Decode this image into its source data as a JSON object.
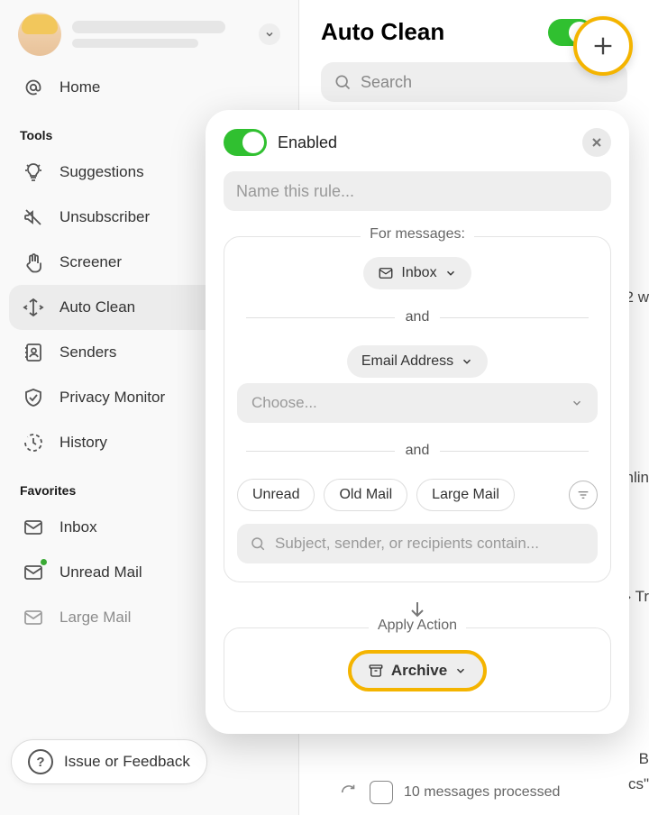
{
  "user": {
    "caret": "⌄"
  },
  "sections": {
    "tools": "Tools",
    "favorites": "Favorites"
  },
  "nav": {
    "home": "Home",
    "suggestions": "Suggestions",
    "unsubscriber": "Unsubscriber",
    "screener": "Screener",
    "auto_clean": "Auto Clean",
    "senders": "Senders",
    "privacy": "Privacy Monitor",
    "history": "History",
    "inbox": "Inbox",
    "unread": "Unread Mail",
    "large": "Large Mail"
  },
  "feedback": "Issue or Feedback",
  "header": {
    "title": "Auto Clean",
    "search_placeholder": "Search"
  },
  "fragments": {
    "a": "2 w",
    "b": "onlin",
    "c": "› Tr",
    "d": "B",
    "e": "cs\""
  },
  "processed": "10 messages processed",
  "modal": {
    "enabled": "Enabled",
    "name_placeholder": "Name this rule...",
    "for_messages": "For messages:",
    "inbox": "Inbox",
    "and": "and",
    "email_address": "Email Address",
    "choose": "Choose...",
    "filters": {
      "unread": "Unread",
      "old": "Old Mail",
      "large": "Large Mail"
    },
    "subject_placeholder": "Subject, sender, or recipients contain...",
    "apply_action": "Apply Action",
    "archive": "Archive"
  }
}
